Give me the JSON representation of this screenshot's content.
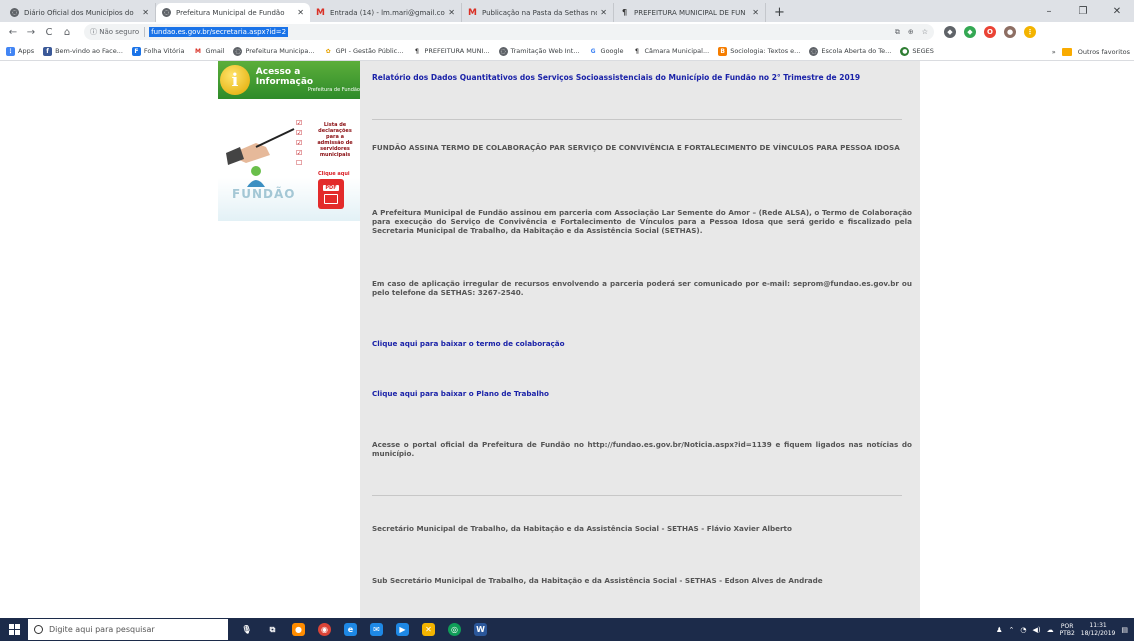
{
  "browser": {
    "tabs": [
      {
        "title": "Diário Oficial dos Municípios do",
        "icon": "globe-icon",
        "active": false
      },
      {
        "title": "Prefeitura Municipal de Fundão",
        "icon": "globe-icon",
        "active": true
      },
      {
        "title": "Entrada (14) - lm.mari@gmail.co",
        "icon": "gmail-icon",
        "active": false
      },
      {
        "title": "Publicação na Pasta da Sethas no",
        "icon": "gmail-icon",
        "active": false
      },
      {
        "title": "PREFEITURA MUNICIPAL DE FUN",
        "icon": "pmf-icon",
        "active": false
      }
    ],
    "new_tab": "+",
    "window_controls": {
      "minimize": "–",
      "maximize": "❐",
      "close": "✕"
    },
    "nav": {
      "back": "←",
      "forward": "→",
      "reload": "C",
      "home": "⌂"
    },
    "security_label": "ⓘ Não seguro",
    "url": "fundao.es.gov.br/secretaria.aspx?id=2",
    "bookmarks": [
      {
        "label": "Apps",
        "icon": "apps-icon",
        "color": "#4285f4"
      },
      {
        "label": "Bem-vindo ao Face...",
        "icon": "facebook-icon",
        "color": "#3b5998"
      },
      {
        "label": "Folha Vitória",
        "icon": "fv-icon",
        "color": "#1a73e8"
      },
      {
        "label": "Gmail",
        "icon": "gmail-icon",
        "color": "#d93025"
      },
      {
        "label": "Prefeitura Municipa...",
        "icon": "globe-icon",
        "color": "#5f6368"
      },
      {
        "label": "GPI - Gestão Públic...",
        "icon": "gpi-icon",
        "color": "#e6a100"
      },
      {
        "label": "PREFEITURA MUNI...",
        "icon": "pmf-icon",
        "color": "#333333"
      },
      {
        "label": "Tramitação Web Int...",
        "icon": "globe-icon",
        "color": "#5f6368"
      },
      {
        "label": "Google",
        "icon": "google-icon",
        "color": "#4285f4"
      },
      {
        "label": "Câmara Municipal...",
        "icon": "pmf-icon",
        "color": "#333333"
      },
      {
        "label": "Sociologia: Textos e...",
        "icon": "blogger-icon",
        "color": "#f57d00"
      },
      {
        "label": "Escola Aberta do Te...",
        "icon": "globe-icon",
        "color": "#5f6368"
      },
      {
        "label": "SEGES",
        "icon": "seges-icon",
        "color": "#2e7d32"
      }
    ],
    "bookmarks_more": "»",
    "other_bookmarks": "Outros favoritos"
  },
  "sidebar": {
    "acesso_title": "Acesso a Informação",
    "acesso_sub": "Prefeitura de Fundão",
    "acesso_icon_letter": "i",
    "promo_list_text": "Lista de declarações para a admissão de servidores municipais",
    "promo_click": "Clique aqui",
    "promo_logo": "FUNDÃO",
    "promo_pdf": "PDF"
  },
  "content": {
    "top_link": "Relatório dos Dados Quantitativos dos Serviços Socioassistenciais do Município de Fundão no 2° Trimestre de 2019",
    "headline": "FUNDÃO ASSINA TERMO DE COLABORAÇÃO PAR SERVIÇO DE CONVIVÊNCIA E FORTALECIMENTO DE VÍNCULOS PARA PESSOA IDOSA",
    "para1": "A Prefeitura Municipal de Fundão assinou em parceria com Associação Lar Semente do Amor – (Rede ALSA), o  Termo de Colaboração para execução do Serviço de Convivência e Fortalecimento de Vínculos para a Pessoa Idosa que será gerido e fiscalizado pela Secretaria Municipal de Trabalho, da Habitação e da Assistência Social (SETHAS).",
    "para2": "Em caso de aplicação irregular de recursos envolvendo a parceria poderá ser comunicado por e-mail: seprom@fundao.es.gov.br ou pelo telefone da SETHAS: 3267-2540.",
    "link1": "Clique aqui para baixar o termo de colaboração",
    "link2": "Clique aqui para baixar o Plano de Trabalho",
    "para3": "Acesse o portal oficial da Prefeitura de Fundão no http://fundao.es.gov.br/Noticia.aspx?id=1139 e fiquem ligados nas notícias do município.",
    "secretary": "Secretário Municipal de Trabalho, da Habitação e da Assistência Social - SETHAS - Flávio Xavier Alberto",
    "subsecretary": "Sub Secretário Municipal de Trabalho, da Habitação e da Assistência Social - SETHAS - Edson Alves de Andrade"
  },
  "taskbar": {
    "search_placeholder": "Digite aqui para pesquisar",
    "apps": [
      {
        "name": "mic-icon",
        "glyph": "🎙",
        "color": "transparent"
      },
      {
        "name": "task-view-icon",
        "glyph": "⧉",
        "color": "transparent"
      },
      {
        "name": "paint-icon",
        "glyph": "●",
        "color": "#ff8c00"
      },
      {
        "name": "chrome-icon",
        "glyph": "◉",
        "color": "#db4437"
      },
      {
        "name": "edge-icon",
        "glyph": "e",
        "color": "#1e88e5"
      },
      {
        "name": "mail-icon",
        "glyph": "✉",
        "color": "#1e88e5"
      },
      {
        "name": "store-icon",
        "glyph": "▶",
        "color": "#1e88e5"
      },
      {
        "name": "tools-icon",
        "glyph": "✕",
        "color": "#f4b400"
      },
      {
        "name": "maps-icon",
        "glyph": "◎",
        "color": "#0f9d58"
      },
      {
        "name": "word-icon",
        "glyph": "W",
        "color": "#2b579a"
      }
    ],
    "lang_line1": "POR",
    "lang_line2": "PTB2",
    "time": "11:31",
    "date": "18/12/2019"
  }
}
